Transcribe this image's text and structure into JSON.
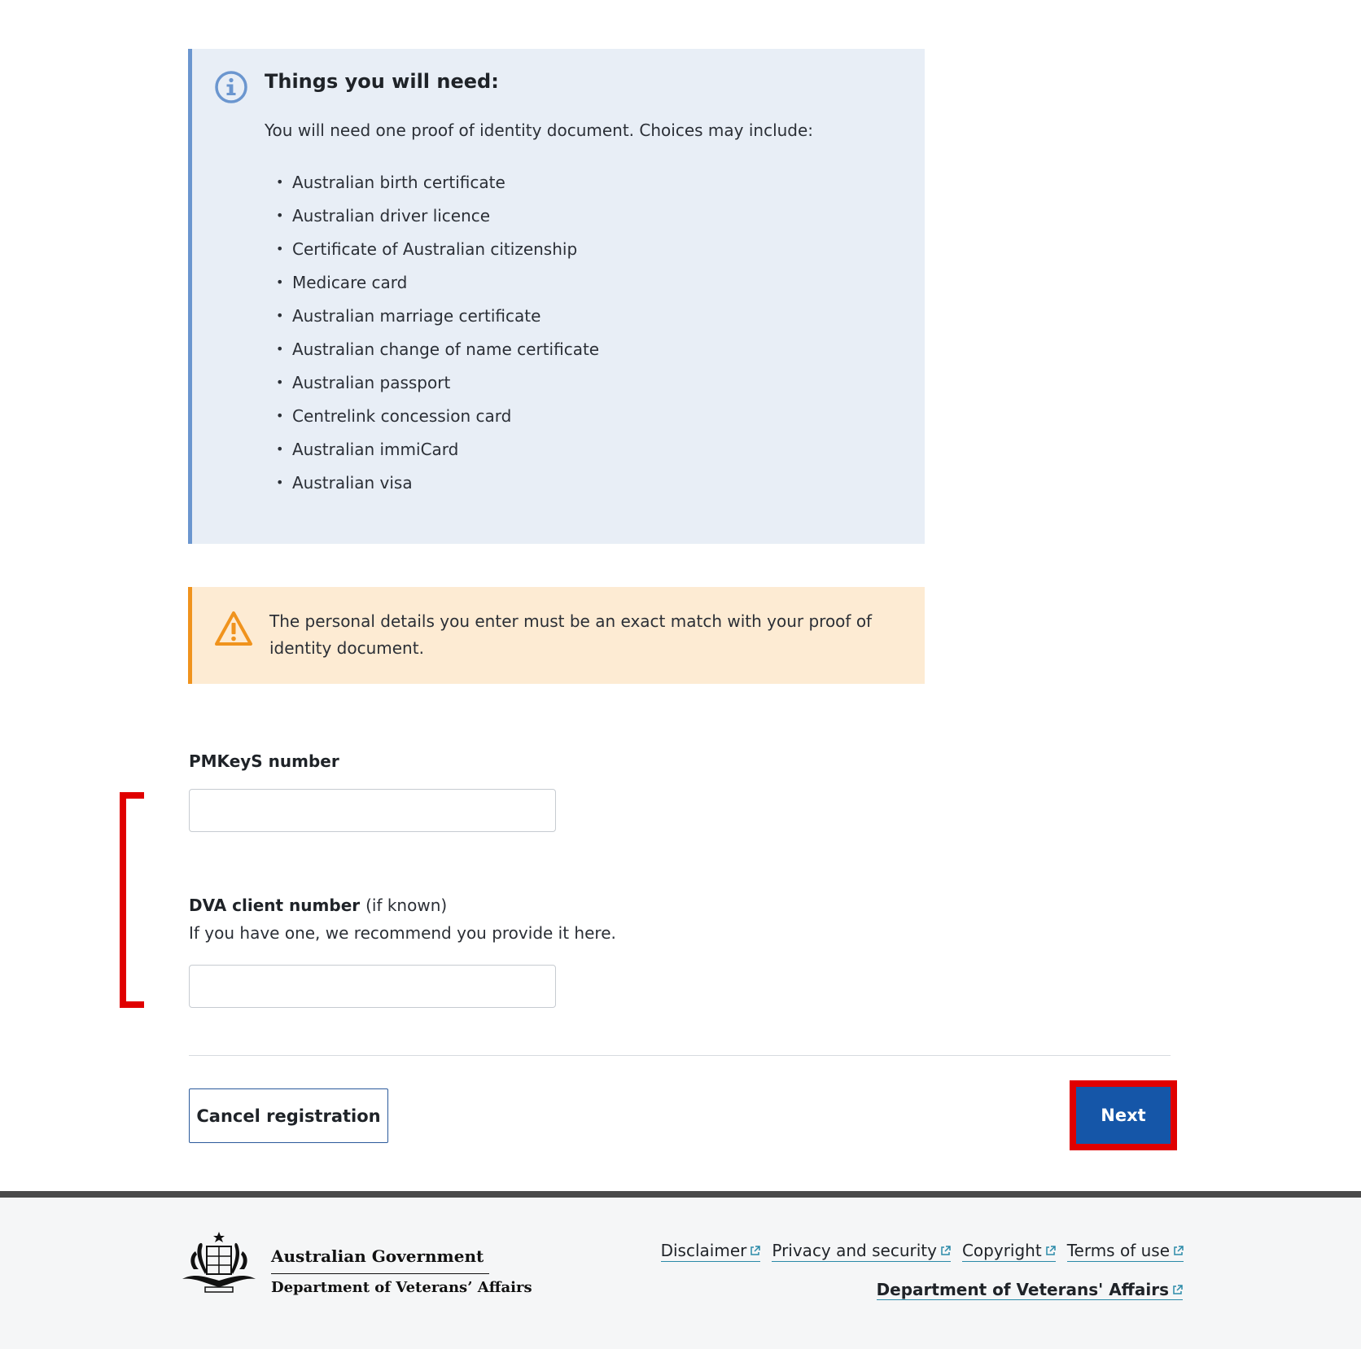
{
  "info": {
    "title": "Things you will need:",
    "intro": "You will need one proof of identity document. Choices may include:",
    "items": [
      "Australian birth certificate",
      "Australian driver licence",
      "Certificate of Australian citizenship",
      "Medicare card",
      "Australian marriage certificate",
      "Australian change of name certificate",
      "Australian passport",
      "Centrelink concession card",
      "Australian immiCard",
      "Australian visa"
    ]
  },
  "warning": {
    "text": "The personal details you enter must be an exact match with your proof of identity document."
  },
  "form": {
    "pmkeys_label": "PMKeyS number",
    "pmkeys_value": "",
    "dva_label": "DVA client number",
    "dva_label_suffix": "(if known)",
    "dva_hint": "If you have one, we recommend you provide it here.",
    "dva_value": ""
  },
  "actions": {
    "cancel_label": "Cancel registration",
    "next_label": "Next"
  },
  "footer": {
    "gov_name": "Australian Government",
    "dept_name": "Department of  Veterans’ Affairs",
    "links": [
      "Disclaimer",
      "Privacy and security",
      "Copyright",
      "Terms of use"
    ],
    "dva_link": "Department of Veterans' Affairs"
  },
  "colors": {
    "info_bg": "#e8eef6",
    "info_accent": "#6b96cf",
    "warn_bg": "#fdebd3",
    "warn_accent": "#f0931d",
    "primary": "#1556a8",
    "highlight": "#e00000"
  }
}
